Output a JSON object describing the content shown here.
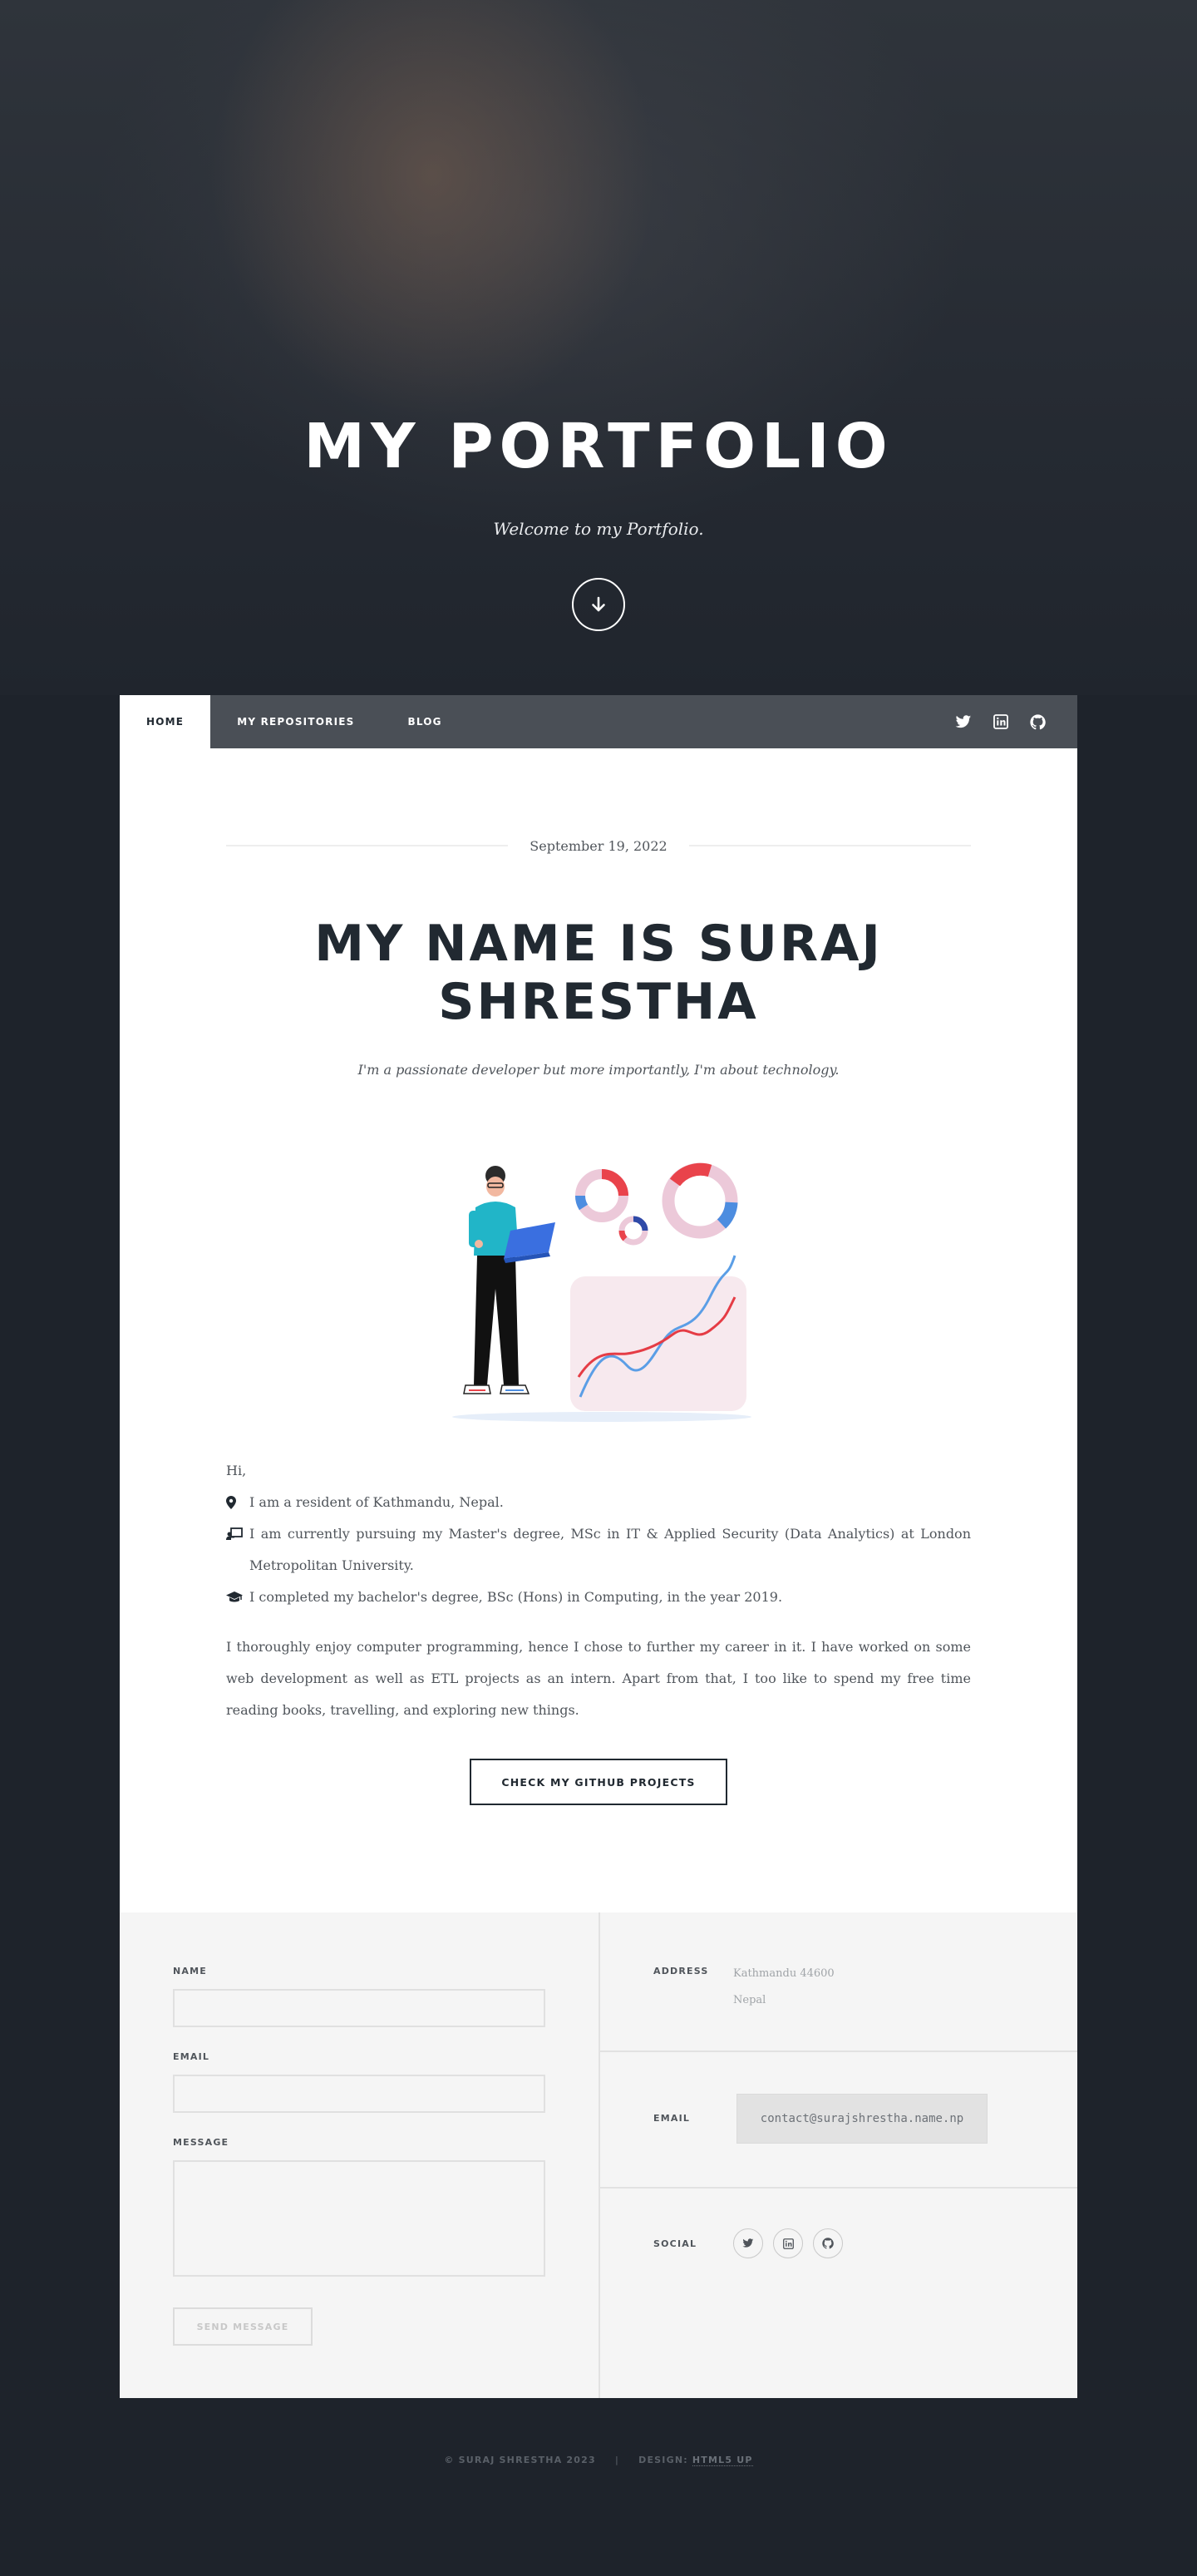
{
  "hero": {
    "title": "MY PORTFOLIO",
    "subtitle": "Welcome to my Portfolio.",
    "scroll_icon": "arrow-down-icon"
  },
  "nav": {
    "items": [
      {
        "label": "HOME",
        "active": true
      },
      {
        "label": "MY REPOSITORIES",
        "active": false
      },
      {
        "label": "BLOG",
        "active": false
      }
    ],
    "social_icons": [
      "twitter-icon",
      "linkedin-icon",
      "github-icon"
    ]
  },
  "post": {
    "date": "September 19, 2022",
    "title": "MY NAME IS SURAJ SHRESTHA",
    "subtitle": "I'm a passionate developer but more importantly, I'm about technology.",
    "greeting": "Hi,",
    "facts": [
      {
        "icon": "map-marker-icon",
        "text": "I am a resident of Kathmandu, Nepal."
      },
      {
        "icon": "chalkboard-teacher-icon",
        "text": "I am currently pursuing my Master's degree, MSc in IT & Applied Security (Data Analytics) at London Metropolitan University."
      },
      {
        "icon": "graduation-cap-icon",
        "text": "I completed my bachelor's degree, BSc (Hons) in Computing, in the year 2019."
      }
    ],
    "paragraph": "I thoroughly enjoy computer programming, hence I chose to further my career in it. I have worked on some web development as well as ETL projects as an intern. Apart from that, I too like to spend my free time reading books, travelling, and exploring new things.",
    "cta_label": "CHECK MY GITHUB PROJECTS"
  },
  "contact_form": {
    "name_label": "NAME",
    "email_label": "EMAIL",
    "message_label": "MESSAGE",
    "send_label": "SEND MESSAGE"
  },
  "contact_info": {
    "address_label": "ADDRESS",
    "address_line1": "Kathmandu 44600",
    "address_line2": "Nepal",
    "email_label": "EMAIL",
    "email": "contact@surajshrestha.name.np",
    "social_label": "SOCIAL",
    "social_icons": [
      "twitter-icon",
      "linkedin-icon",
      "github-icon"
    ]
  },
  "footer": {
    "copyright": "© SURAJ SHRESTHA 2023",
    "separator": "|",
    "design_label": "DESIGN:",
    "design_link": "HTML5 UP"
  },
  "colors": {
    "page_bg": "#1e232b",
    "nav_bg": "#4a4f56",
    "text_dark": "#212931",
    "text_muted": "#50555b",
    "panel_bg": "#f5f5f5"
  }
}
